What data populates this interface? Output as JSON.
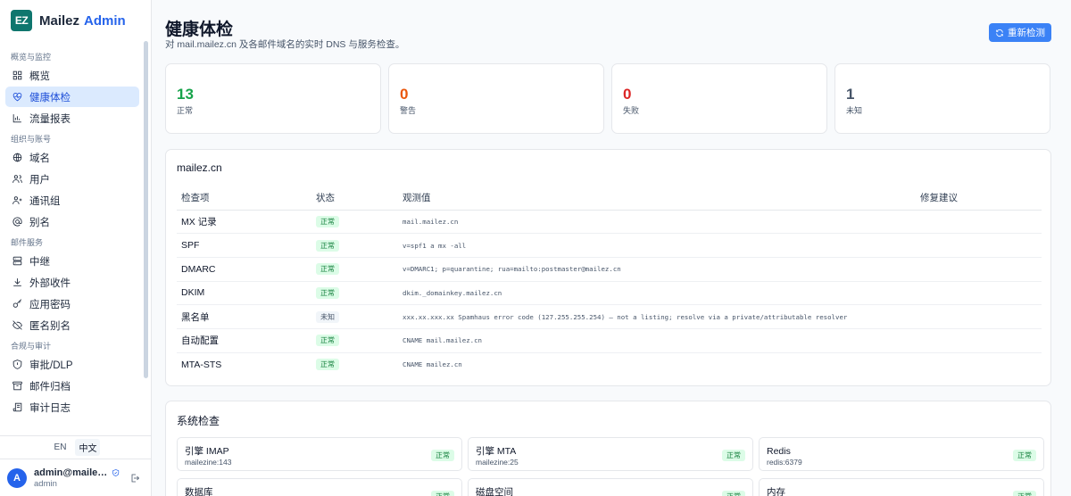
{
  "brand": {
    "logo": "EZ",
    "name": "Mailez",
    "suffix": "Admin"
  },
  "sidebar": {
    "sections": [
      {
        "label": "概览与监控",
        "items": [
          {
            "label": "概览",
            "icon": "grid-icon"
          },
          {
            "label": "健康体检",
            "icon": "heart-pulse-icon",
            "active": true
          },
          {
            "label": "流量报表",
            "icon": "bar-chart-icon"
          }
        ]
      },
      {
        "label": "组织与账号",
        "items": [
          {
            "label": "域名",
            "icon": "globe-icon"
          },
          {
            "label": "用户",
            "icon": "users-icon"
          },
          {
            "label": "通讯组",
            "icon": "group-icon"
          },
          {
            "label": "别名",
            "icon": "at-sign-icon"
          }
        ]
      },
      {
        "label": "邮件服务",
        "items": [
          {
            "label": "中继",
            "icon": "server-icon"
          },
          {
            "label": "外部收件",
            "icon": "download-icon"
          },
          {
            "label": "应用密码",
            "icon": "key-icon"
          },
          {
            "label": "匿名别名",
            "icon": "eye-off-icon"
          }
        ]
      },
      {
        "label": "合规与审计",
        "items": [
          {
            "label": "审批/DLP",
            "icon": "shield-icon"
          },
          {
            "label": "邮件归档",
            "icon": "archive-icon"
          },
          {
            "label": "审计日志",
            "icon": "scroll-icon"
          }
        ]
      }
    ],
    "lang": {
      "en": "EN",
      "zh": "中文"
    },
    "user": {
      "avatar": "A",
      "name": "admin@mailez....",
      "role": "admin"
    }
  },
  "page": {
    "title": "健康体检",
    "subtitle": "对 mail.mailez.cn 及各邮件域名的实时 DNS 与服务检查。",
    "refresh_label": "重新检测"
  },
  "stats": [
    {
      "value": "13",
      "label": "正常",
      "color": "#16a34a"
    },
    {
      "value": "0",
      "label": "警告",
      "color": "#ea580c"
    },
    {
      "value": "0",
      "label": "失败",
      "color": "#dc2626"
    },
    {
      "value": "1",
      "label": "未知",
      "color": "#475569"
    }
  ],
  "domain_check": {
    "title": "mailez.cn",
    "headers": {
      "item": "检查项",
      "status": "状态",
      "observed": "观测值",
      "fix": "修复建议"
    },
    "rows": [
      {
        "item": "MX 记录",
        "status": "正常",
        "kind": "ok",
        "observed": "mail.mailez.cn",
        "fix": ""
      },
      {
        "item": "SPF",
        "status": "正常",
        "kind": "ok",
        "observed": "v=spf1 a mx -all",
        "fix": ""
      },
      {
        "item": "DMARC",
        "status": "正常",
        "kind": "ok",
        "observed": "v=DMARC1; p=quarantine; rua=mailto:postmaster@mailez.cn",
        "fix": ""
      },
      {
        "item": "DKIM",
        "status": "正常",
        "kind": "ok",
        "observed": "dkim._domainkey.mailez.cn",
        "fix": ""
      },
      {
        "item": "黑名单",
        "status": "未知",
        "kind": "unk",
        "observed": "xxx.xx.xxx.xx Spamhaus error code (127.255.255.254) — not a listing; resolve via a private/attributable resolver",
        "fix": ""
      },
      {
        "item": "自动配置",
        "status": "正常",
        "kind": "ok",
        "observed": "CNAME mail.mailez.cn",
        "fix": ""
      },
      {
        "item": "MTA-STS",
        "status": "正常",
        "kind": "ok",
        "observed": "CNAME mailez.cn",
        "fix": ""
      }
    ]
  },
  "system_check": {
    "title": "系统检查",
    "items": [
      {
        "name": "引擎 IMAP",
        "detail": "mailezine:143",
        "status": "正常"
      },
      {
        "name": "引擎 MTA",
        "detail": "mailezine:25",
        "status": "正常"
      },
      {
        "name": "Redis",
        "detail": "redis:6379",
        "status": "正常"
      },
      {
        "name": "数据库",
        "detail": "",
        "status": "正常"
      },
      {
        "name": "磁盘空间",
        "detail": "",
        "status": "正常"
      },
      {
        "name": "内存",
        "detail": "",
        "status": "正常"
      }
    ]
  }
}
